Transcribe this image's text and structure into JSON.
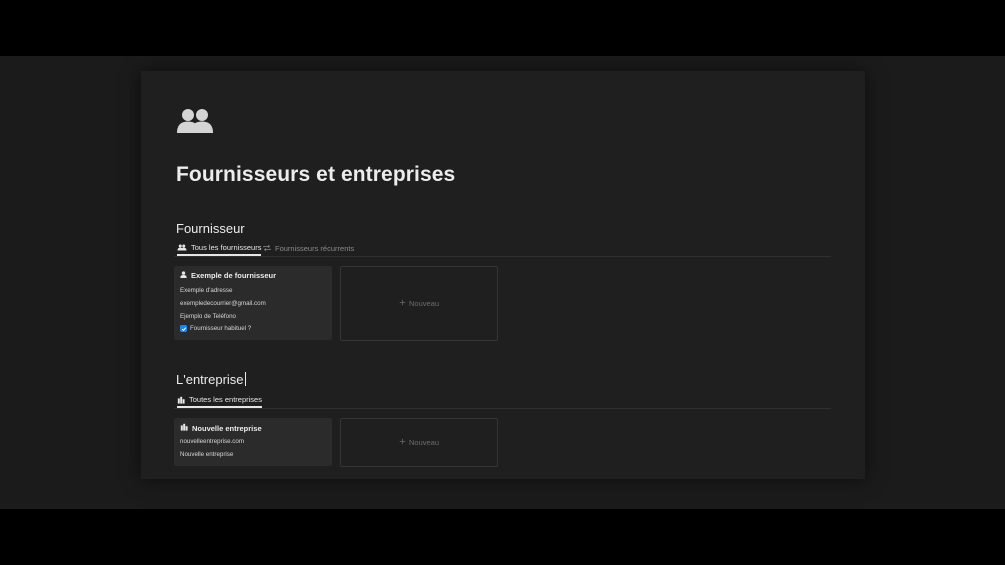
{
  "page": {
    "icon": "people-icon",
    "title": "Fournisseurs et entreprises"
  },
  "suppliers": {
    "heading": "Fournisseur",
    "tabs": [
      {
        "label": "Tous les fournisseurs",
        "icon": "people-icon",
        "active": true
      },
      {
        "label": "Fournisseurs récurrents",
        "icon": "repeat-icon",
        "active": false
      }
    ],
    "card": {
      "icon": "person-icon",
      "title": "Exemple de fournisseur",
      "address": "Exemple d'adresse",
      "email": "exempledecourrier@gmail.com",
      "phone": "Ejemplo de Teléfono",
      "checkbox_label": "Fournisseur habituel ?",
      "checkbox_checked": true
    },
    "new_label": "Nouveau"
  },
  "companies": {
    "heading": "L'entreprise",
    "tabs": [
      {
        "label": "Toutes les entreprises",
        "icon": "building-icon",
        "active": true
      }
    ],
    "card": {
      "icon": "building-icon",
      "title": "Nouvelle entreprise",
      "website": "nouvelleentreprise.com",
      "name": "Nouvelle entreprise"
    },
    "new_label": "Nouveau"
  },
  "colors": {
    "background": "#1f1f1f",
    "card": "#2b2b2b",
    "checkbox": "#2383e2"
  }
}
